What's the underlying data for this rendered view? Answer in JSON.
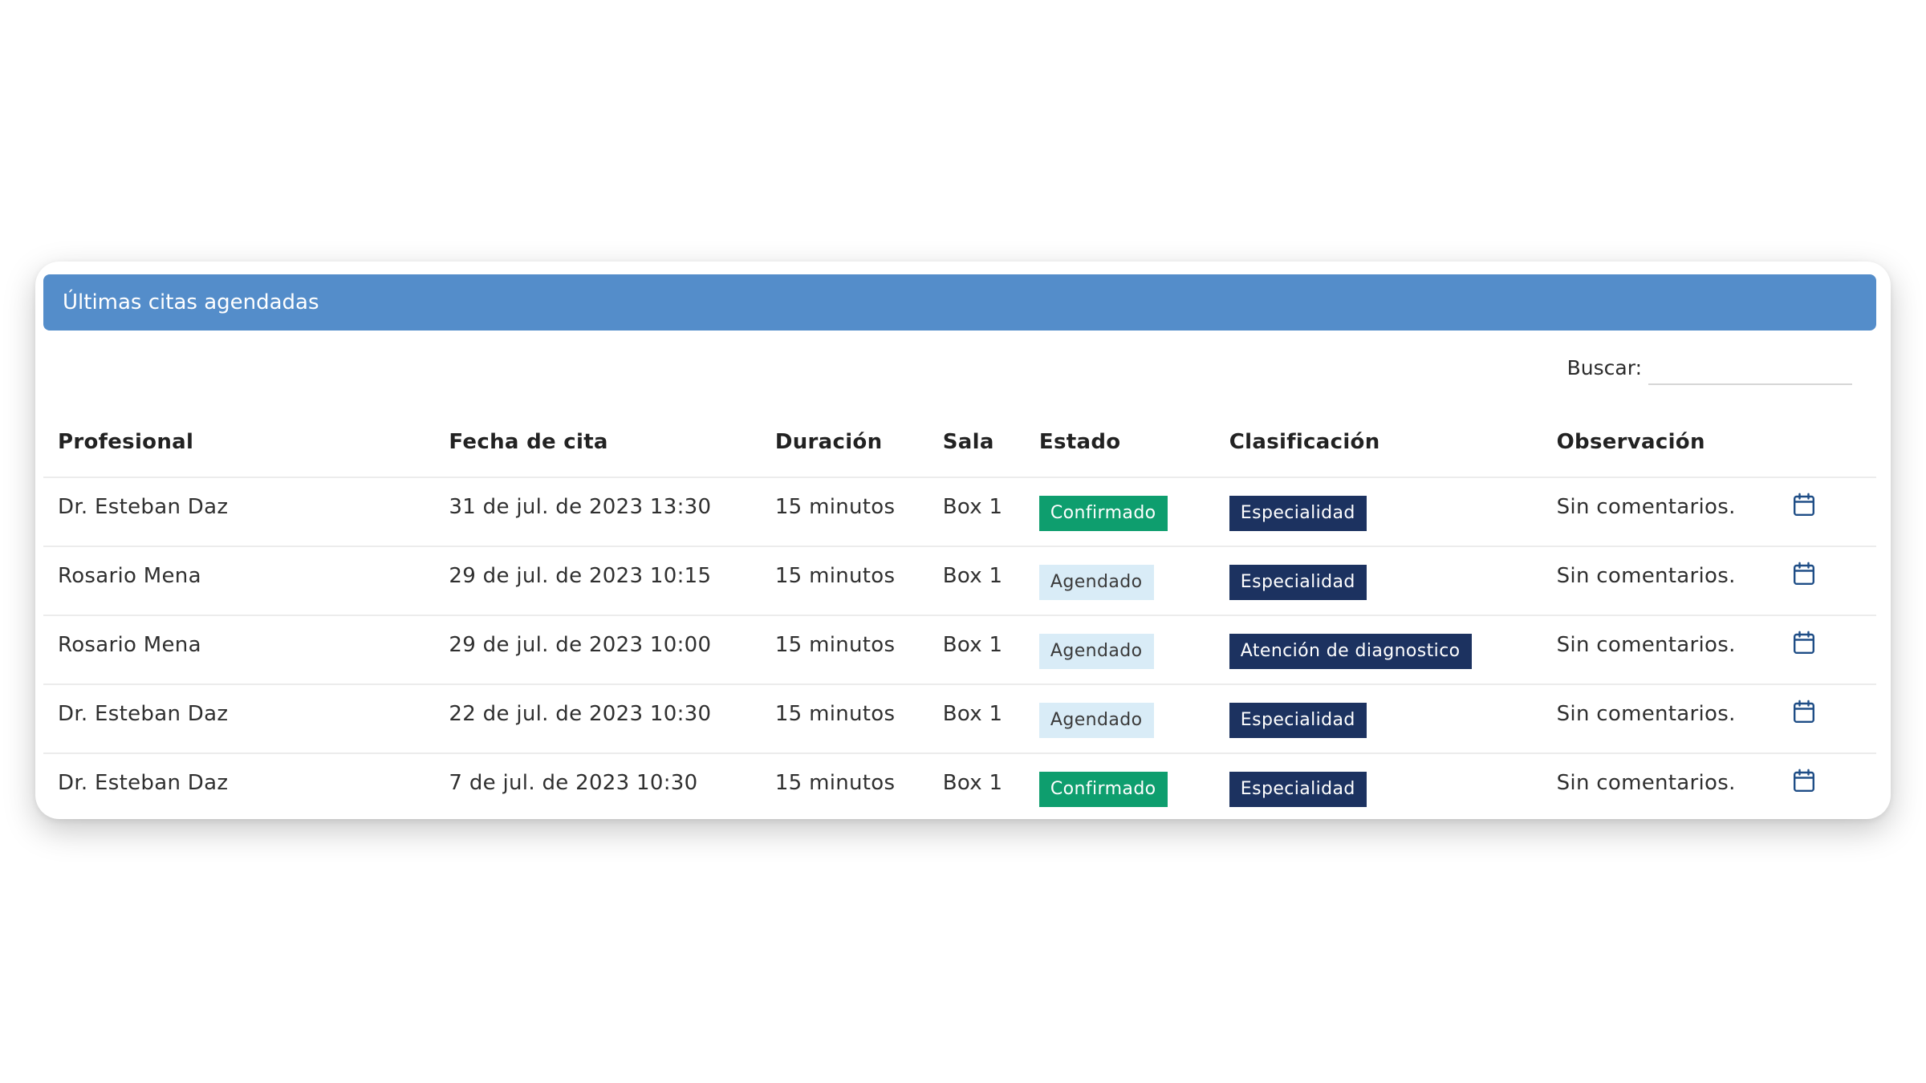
{
  "card": {
    "title": "Últimas citas agendadas",
    "header_color": "#548dca"
  },
  "search": {
    "label": "Buscar:",
    "value": "",
    "placeholder": ""
  },
  "table": {
    "columns": {
      "profesional": "Profesional",
      "fecha": "Fecha de cita",
      "duracion": "Duración",
      "sala": "Sala",
      "estado": "Estado",
      "clasificacion": "Clasificación",
      "observacion": "Observación"
    },
    "rows": [
      {
        "profesional": "Dr. Esteban Daz",
        "fecha": "31 de jul. de 2023 13:30",
        "duracion": "15 minutos",
        "sala": "Box 1",
        "estado": "Confirmado",
        "clasificacion": "Especialidad",
        "observacion": "Sin comentarios.",
        "action_icon": "calendar-icon"
      },
      {
        "profesional": "Rosario Mena",
        "fecha": "29 de jul. de 2023 10:15",
        "duracion": "15 minutos",
        "sala": "Box 1",
        "estado": "Agendado",
        "clasificacion": "Especialidad",
        "observacion": "Sin comentarios.",
        "action_icon": "calendar-icon"
      },
      {
        "profesional": "Rosario Mena",
        "fecha": "29 de jul. de 2023 10:00",
        "duracion": "15 minutos",
        "sala": "Box 1",
        "estado": "Agendado",
        "clasificacion": "Atención de diagnostico",
        "observacion": "Sin comentarios.",
        "action_icon": "calendar-icon"
      },
      {
        "profesional": "Dr. Esteban Daz",
        "fecha": "22 de jul. de 2023 10:30",
        "duracion": "15 minutos",
        "sala": "Box 1",
        "estado": "Agendado",
        "clasificacion": "Especialidad",
        "observacion": "Sin comentarios.",
        "action_icon": "calendar-icon"
      },
      {
        "profesional": "Dr. Esteban Daz",
        "fecha": "7 de jul. de 2023 10:30",
        "duracion": "15 minutos",
        "sala": "Box 1",
        "estado": "Confirmado",
        "clasificacion": "Especialidad",
        "observacion": "Sin comentarios.",
        "action_icon": "calendar-icon"
      }
    ]
  },
  "colors": {
    "confirmado": "#0e9e6e",
    "agendado": "#d9ecf7",
    "clasificacion": "#1c3260"
  }
}
